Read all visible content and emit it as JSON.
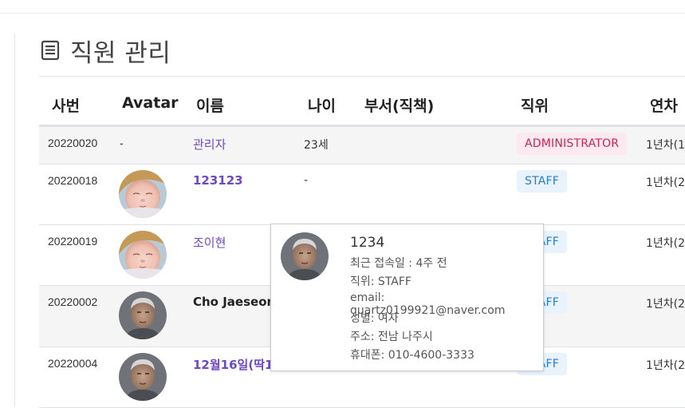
{
  "page": {
    "title": "직원 관리",
    "title_icon": "document-list-icon"
  },
  "table": {
    "headers": [
      "사번",
      "Avatar",
      "이름",
      "나이",
      "부서(직책)",
      "직위",
      "연차"
    ],
    "rows": [
      {
        "emp_no": "20220020",
        "avatar": "-",
        "name": "관리자",
        "age": "23세",
        "dept": "",
        "position": "ADMINISTRATOR",
        "years": "1년차(1"
      },
      {
        "emp_no": "20220018",
        "avatar": "baby-photo",
        "name": "123123",
        "age": "-",
        "dept": "",
        "position": "STAFF",
        "years": "1년차(2"
      },
      {
        "emp_no": "20220019",
        "avatar": "baby-photo",
        "name": "조이현",
        "age": "",
        "dept": "",
        "position": "STAFF",
        "years": "1년차(2"
      },
      {
        "emp_no": "20220002",
        "avatar": "man-photo",
        "name": "Cho Jaeseong",
        "age": "",
        "dept": "",
        "position": "STAFF",
        "years": "1년차(2"
      },
      {
        "emp_no": "20220004",
        "avatar": "man-photo",
        "name": "12월16일(딱1",
        "age": "",
        "dept": "",
        "position": "STAFF",
        "years": "1년차(2"
      }
    ]
  },
  "popover": {
    "name": "1234",
    "last_login": "최근 접속일 : 4주 전",
    "position": "직위: STAFF",
    "email": "email: quartz0199921@naver.com",
    "gender": "성별: 여자",
    "address": "주소: 전남 나주시",
    "phone": "휴대폰: 010-4600-3333"
  },
  "colors": {
    "name_link": "#7048c6",
    "admin_badge": "#cf2455",
    "staff_badge": "#2a7bd2"
  }
}
